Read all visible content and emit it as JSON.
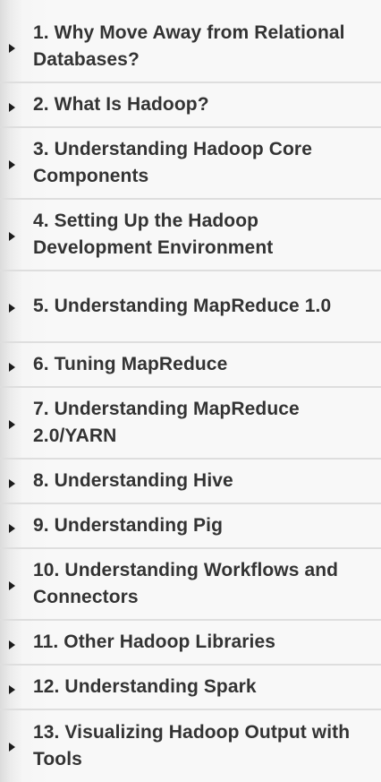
{
  "toc": {
    "items": [
      {
        "label": "1. Why Move Away from Relational Databases?"
      },
      {
        "label": "2. What Is Hadoop?"
      },
      {
        "label": "3. Understanding Hadoop Core Components"
      },
      {
        "label": "4. Setting Up the Hadoop Development Environment"
      },
      {
        "label": "5. Understanding MapReduce 1.0"
      },
      {
        "label": "6. Tuning MapReduce"
      },
      {
        "label": "7. Understanding MapReduce 2.0/YARN"
      },
      {
        "label": "8. Understanding Hive"
      },
      {
        "label": "9. Understanding Pig"
      },
      {
        "label": "10. Understanding Workflows and Connectors"
      },
      {
        "label": "11. Other Hadoop Libraries"
      },
      {
        "label": "12. Understanding Spark"
      },
      {
        "label": "13. Visualizing Hadoop Output with Tools"
      }
    ],
    "icon": "caret-right-icon"
  }
}
